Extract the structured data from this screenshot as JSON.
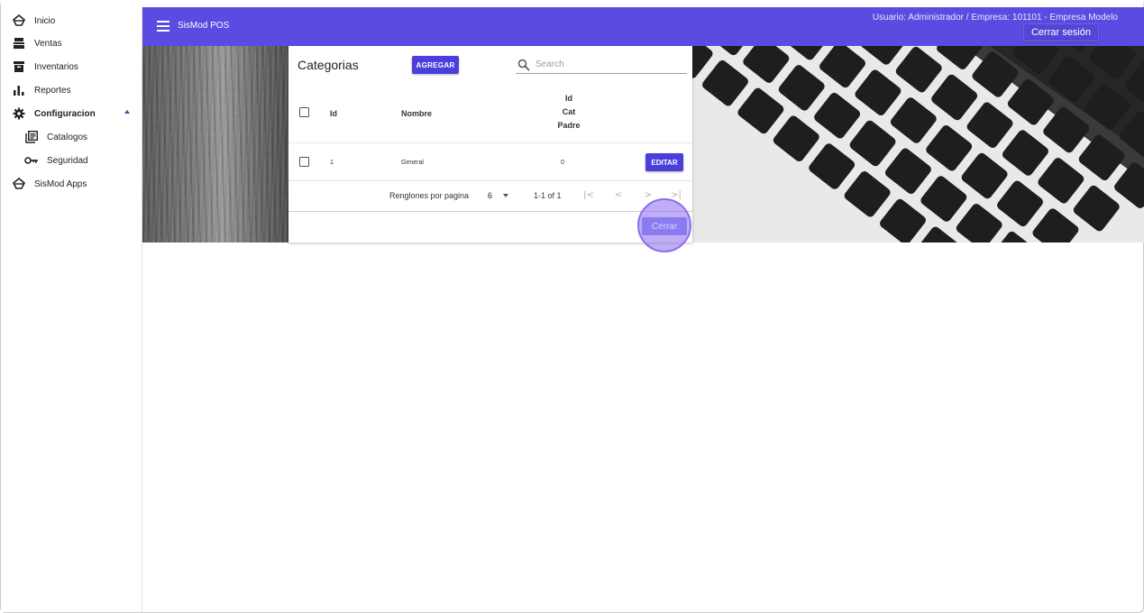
{
  "sidebar": {
    "items": [
      {
        "label": "Inicio",
        "icon": "sismod-logo-icon"
      },
      {
        "label": "Ventas",
        "icon": "register-icon"
      },
      {
        "label": "Inventarios",
        "icon": "archive-icon"
      },
      {
        "label": "Reportes",
        "icon": "bar-chart-icon"
      },
      {
        "label": "Configuracion",
        "icon": "gear-icon",
        "expanded": true
      },
      {
        "label": "Catalogos",
        "icon": "library-books-icon"
      },
      {
        "label": "Seguridad",
        "icon": "key-icon"
      },
      {
        "label": "SisMod Apps",
        "icon": "sismod-logo-icon"
      }
    ]
  },
  "header": {
    "app_title": "SisMod POS",
    "user_info": "Usuario: Administrador / Empresa: 101101 - Empresa Modelo",
    "logout_label": "Cerrar sesión",
    "accent_color": "#5a4ce0"
  },
  "card": {
    "title": "Categorias",
    "add_label": "AGREGAR",
    "search_placeholder": "Search",
    "columns": {
      "id": "Id",
      "nombre": "Nombre",
      "padre_l1": "Id",
      "padre_l2": "Cat",
      "padre_l3": "Padre"
    },
    "rows": [
      {
        "id": "1",
        "nombre": "General",
        "padre": "0",
        "edit_label": "EDITAR"
      }
    ],
    "pagination": {
      "rows_label": "Renglones por pagina",
      "rows_per_page": "6",
      "range": "1-1 of 1"
    },
    "close_label": "Cerrar"
  }
}
